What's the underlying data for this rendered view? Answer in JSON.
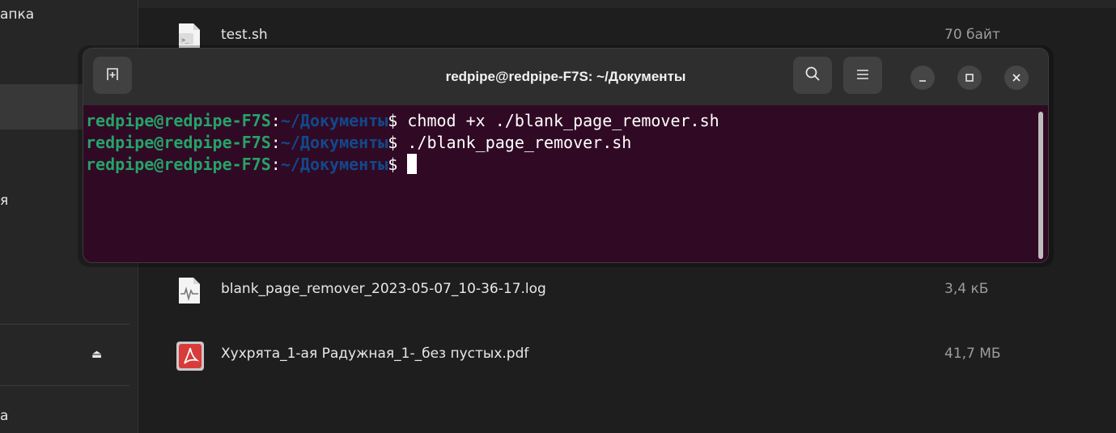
{
  "sidebar": {
    "partial_labels": [
      "апка",
      "я",
      "а"
    ],
    "eject_glyph": "⏏"
  },
  "files": [
    {
      "name": "test.sh",
      "size": "70 байт",
      "icon": "script-file-icon"
    },
    {
      "name": "blank_page_remover_2023-05-07_10-36-17.log",
      "size": "3,4 кБ",
      "icon": "log-file-icon"
    },
    {
      "name": "Хухрята_1-ая Радужная_1-_без пустых.pdf",
      "size": "41,7 МБ",
      "icon": "pdf-file-icon"
    }
  ],
  "terminal": {
    "title": "redpipe@redpipe-F7S: ~/Документы",
    "buttons": {
      "new_tab": "new-tab-icon",
      "search": "search-icon",
      "menu": "hamburger-menu-icon",
      "minimize": "minimize-icon",
      "maximize": "maximize-icon",
      "close": "close-icon"
    },
    "lines": [
      {
        "user": "redpipe@redpipe-F7S",
        "colon": ":",
        "path": "~/Документы",
        "sign": "$",
        "cmd": " chmod +x ./blank_page_remover.sh"
      },
      {
        "user": "redpipe@redpipe-F7S",
        "colon": ":",
        "path": "~/Документы",
        "sign": "$",
        "cmd": " ./blank_page_remover.sh"
      },
      {
        "user": "redpipe@redpipe-F7S",
        "colon": ":",
        "path": "~/Документы",
        "sign": "$",
        "cmd": " "
      }
    ]
  },
  "colors": {
    "terminal_bg": "#300a24",
    "prompt_user": "#26a269",
    "prompt_path": "#12488b"
  }
}
